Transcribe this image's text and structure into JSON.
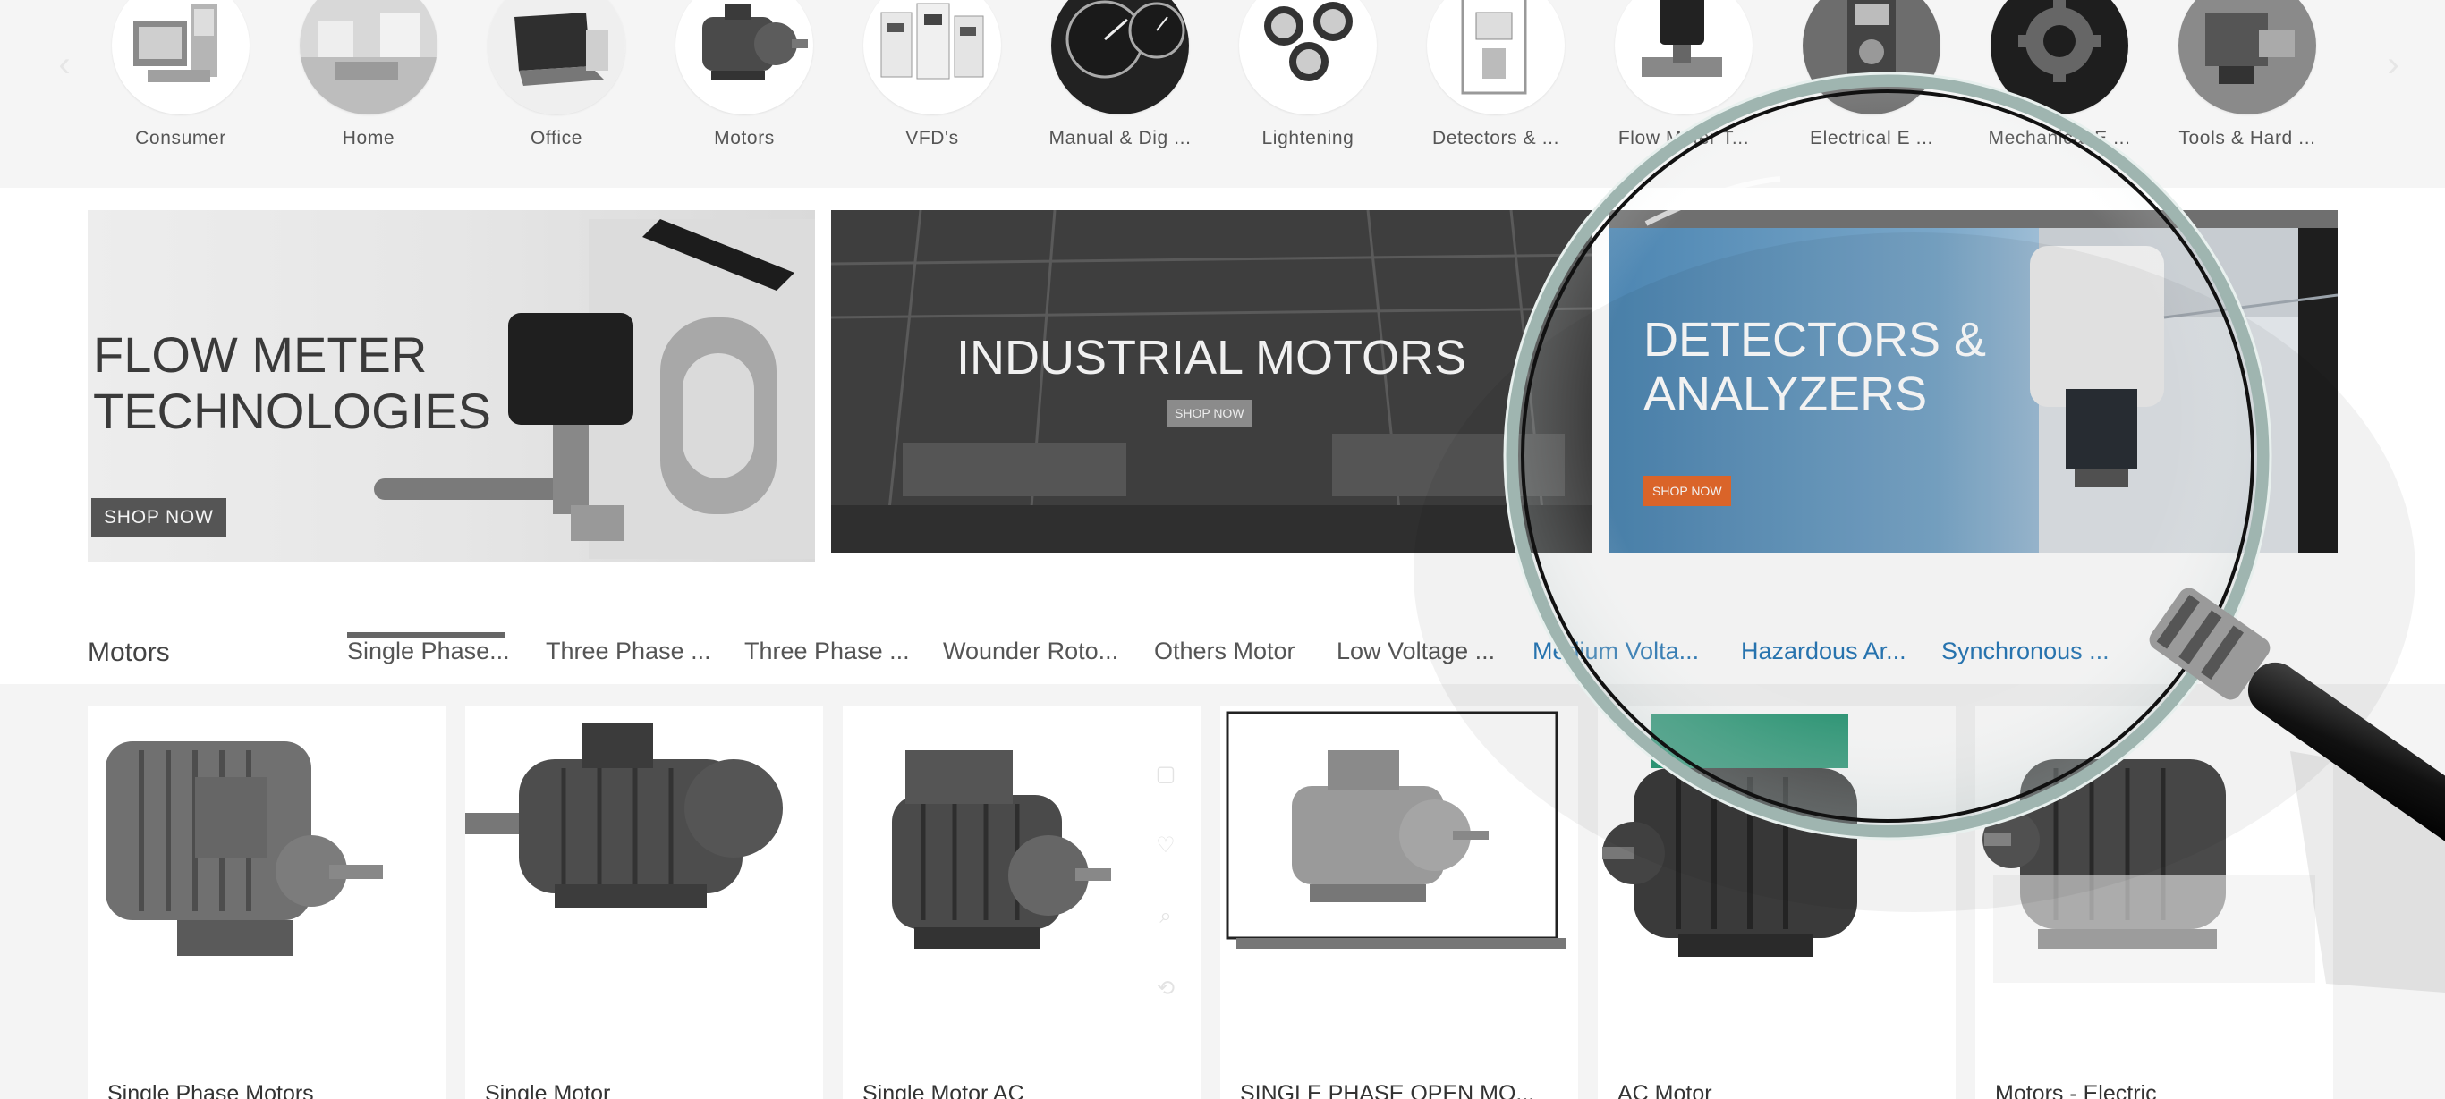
{
  "categories": [
    {
      "label": "Consumer",
      "icon": "consumer-products-icon"
    },
    {
      "label": "Home",
      "icon": "home-icon"
    },
    {
      "label": "Office",
      "icon": "office-icon"
    },
    {
      "label": "Motors",
      "icon": "motor-icon"
    },
    {
      "label": "VFD's",
      "icon": "vfd-icon"
    },
    {
      "label": "Manual & Dig ...",
      "icon": "gauge-icon"
    },
    {
      "label": "Lightening",
      "icon": "lamp-icon"
    },
    {
      "label": "Detectors & ...",
      "icon": "detector-icon"
    },
    {
      "label": "Flow Meter T...",
      "icon": "valve-icon"
    },
    {
      "label": "Electrical E ...",
      "icon": "multimeter-icon"
    },
    {
      "label": "Mechanical E ...",
      "icon": "gear-icon"
    },
    {
      "label": "Tools & Hard ...",
      "icon": "tools-icon"
    }
  ],
  "carousel": {
    "prev_icon": "chevron-left-icon",
    "next_icon": "chevron-right-icon"
  },
  "banners": [
    {
      "title_line1": "FLOW METER",
      "title_line2": "TECHNOLOGIES",
      "button": "SHOP NOW"
    },
    {
      "title_line1": "INDUSTRIAL MOTORS",
      "button": "SHOP NOW"
    },
    {
      "title_line1": "DETECTORS &",
      "title_line2": "ANALYZERS",
      "button": "SHOP NOW"
    }
  ],
  "section": {
    "title": "Motors",
    "tabs": [
      {
        "label": "Single Phase...",
        "active": true
      },
      {
        "label": "Three Phase ..."
      },
      {
        "label": "Three Phase ..."
      },
      {
        "label": "Wounder Roto..."
      },
      {
        "label": "Others Motor"
      },
      {
        "label": "Low Voltage ..."
      },
      {
        "label": "Medium Volta..."
      },
      {
        "label": "Hazardous Ar..."
      },
      {
        "label": "Synchronous ..."
      }
    ]
  },
  "products": [
    {
      "name": "Single Phase Motors"
    },
    {
      "name": "Single Motor"
    },
    {
      "name": "Single Motor AC"
    },
    {
      "name": "SINGLE PHASE OPEN MO..."
    },
    {
      "name": "AC Motor"
    },
    {
      "name": "Motors - Electric"
    }
  ],
  "product_actions": [
    "cart-icon",
    "heart-icon",
    "zoom-icon",
    "compare-icon"
  ],
  "colors": {
    "accent_blue": "#2a7ab8",
    "orange_button": "#e66a2c",
    "banner_blue": "#4d86b2",
    "tab_underline": "#666666"
  }
}
